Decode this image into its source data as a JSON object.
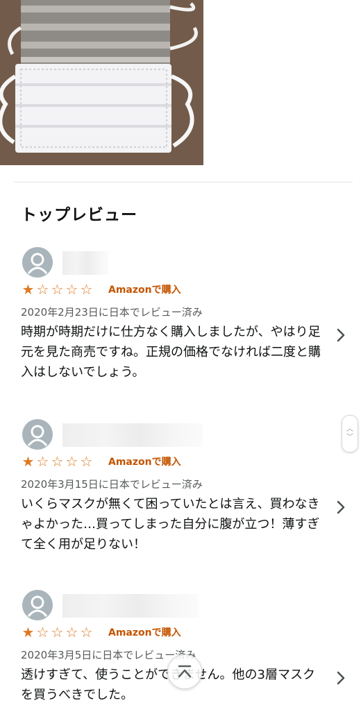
{
  "section": {
    "title": "トップレビュー"
  },
  "reviews": [
    {
      "rating": 1,
      "badge": "Amazonで購入",
      "date": "2020年2月23日に日本でレビュー済み",
      "text": "時期が時期だけに仕方なく購入しましたが、やはり足元を見た商売ですね。正規の価格でなければ二度と購入はしないでしょう。"
    },
    {
      "rating": 1,
      "badge": "Amazonで購入",
      "date": "2020年3月15日に日本でレビュー済み",
      "text": "いくらマスクが無くて困っていたとは言え、買わなきゃよかった…買ってしまった自分に腹が立つ！薄すぎて全く用が足りない！"
    },
    {
      "rating": 1,
      "badge": "Amazonで購入",
      "date": "2020年3月5日に日本でレビュー済み",
      "text": "透けすぎて、使うことができません。他の3層マスクを買うべきでした。"
    }
  ],
  "icons": {
    "avatar": "user-silhouette-icon",
    "chevron": "chevron-right-icon",
    "back_to_top": "chevron-up-icon",
    "star": "star-icon"
  },
  "colors": {
    "star": "#de7921",
    "badge": "#c45500",
    "date": "#565959",
    "avatar_bg": "#a9b5bb"
  }
}
